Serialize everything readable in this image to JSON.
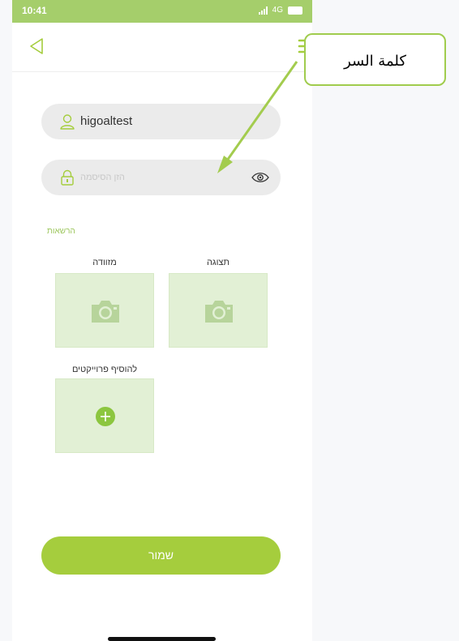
{
  "status_bar": {
    "time": "10:41",
    "network": "4G"
  },
  "form": {
    "username_value": "higoaltest",
    "password_placeholder": "הזן הסיסמה"
  },
  "permissions": {
    "section_label": "הרשאות",
    "slots": [
      {
        "label": "תצוגה",
        "icon": "camera-icon"
      },
      {
        "label": "מזוודה",
        "icon": "camera-icon"
      },
      {
        "label": "להוסיף פרוייקטים",
        "icon": "plus-circle-icon"
      }
    ]
  },
  "save_button_label": "שמור",
  "callout": {
    "text": "كلمة السر"
  },
  "colors": {
    "accent": "#a5cd3d",
    "status_bar": "#a5ce6b",
    "slot_bg": "#e2f0d5",
    "callout_border": "#a0cc4d"
  }
}
